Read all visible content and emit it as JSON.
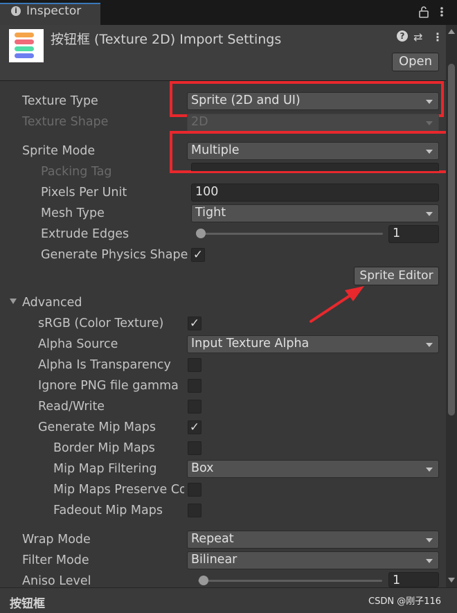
{
  "tab": {
    "label": "Inspector",
    "info_icon": "info-icon",
    "lock_icon": "lock-icon",
    "menu_icon": "kebab-menu-icon"
  },
  "header": {
    "title": "按钮框 (Texture 2D) Import Settings",
    "help_icon": "?",
    "preset_icon": "⇄",
    "menu_icon": "⋮",
    "open_label": "Open"
  },
  "settings": {
    "texture_type": {
      "label": "Texture Type",
      "value": "Sprite (2D and UI)"
    },
    "texture_shape": {
      "label": "Texture Shape",
      "value": "2D"
    },
    "sprite_mode": {
      "label": "Sprite Mode",
      "value": "Multiple"
    },
    "packing_tag": {
      "label": "Packing Tag",
      "value": ""
    },
    "pixels_per_unit": {
      "label": "Pixels Per Unit",
      "value": "100"
    },
    "mesh_type": {
      "label": "Mesh Type",
      "value": "Tight"
    },
    "extrude_edges": {
      "label": "Extrude Edges",
      "value": "1",
      "slider_fraction": 0.04
    },
    "generate_physics_shape": {
      "label": "Generate Physics Shape",
      "checked": "✓"
    },
    "sprite_editor_label": "Sprite Editor"
  },
  "advanced": {
    "label": "Advanced",
    "srgb": {
      "label": "sRGB (Color Texture)",
      "checked": "✓"
    },
    "alpha_source": {
      "label": "Alpha Source",
      "value": "Input Texture Alpha"
    },
    "alpha_is_transparency": {
      "label": "Alpha Is Transparency",
      "checked": ""
    },
    "ignore_png_gamma": {
      "label": "Ignore PNG file gamma",
      "checked": ""
    },
    "read_write": {
      "label": "Read/Write",
      "checked": ""
    },
    "generate_mip_maps": {
      "label": "Generate Mip Maps",
      "checked": "✓"
    },
    "border_mip_maps": {
      "label": "Border Mip Maps",
      "checked": ""
    },
    "mip_map_filtering": {
      "label": "Mip Map Filtering",
      "value": "Box"
    },
    "mip_maps_preserve_coverage": {
      "label": "Mip Maps Preserve Coverage",
      "checked": ""
    },
    "fadeout_mip_maps": {
      "label": "Fadeout Mip Maps",
      "checked": ""
    }
  },
  "wrap_mode": {
    "label": "Wrap Mode",
    "value": "Repeat"
  },
  "filter_mode": {
    "label": "Filter Mode",
    "value": "Bilinear"
  },
  "aniso_level": {
    "label": "Aniso Level",
    "value": "1",
    "slider_fraction": 0.0
  },
  "footer": {
    "label": "按钮框"
  },
  "watermark": "CSDN @刚子116",
  "colors": {
    "highlight": "#e8282d",
    "background": "#383838",
    "arrow": "#e8282d"
  }
}
